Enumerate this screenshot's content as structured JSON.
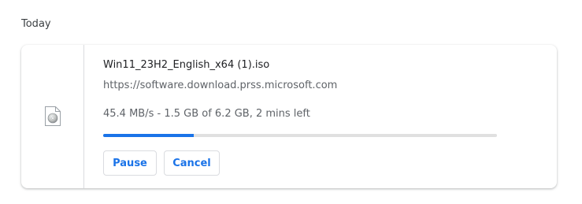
{
  "section": {
    "heading": "Today"
  },
  "download": {
    "filename": "Win11_23H2_English_x64 (1).iso",
    "url": "https://software.download.prss.microsoft.com",
    "status": "45.4 MB/s - 1.5 GB of 6.2 GB, 2 mins left",
    "progress_fraction": 0.23,
    "file_icon": "disc-image-file-icon",
    "buttons": {
      "pause_label": "Pause",
      "cancel_label": "Cancel"
    }
  },
  "colors": {
    "accent": "#1a73e8",
    "track": "#e0e0e0",
    "secondary_text": "#5f6368",
    "primary_text": "#202124"
  }
}
